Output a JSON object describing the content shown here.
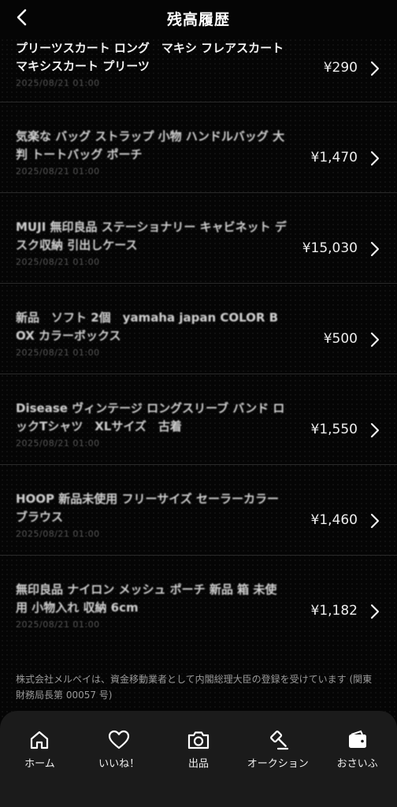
{
  "header": {
    "title": "残高履歴"
  },
  "transactions": [
    {
      "title": "プリーツスカート ロング　マキシ フレアスカート マキシスカート プリーツ",
      "date": "2025/08/21 01:00",
      "amount": "¥290"
    },
    {
      "title": "気楽な バッグ ストラップ 小物 ハンドルバッグ 大判 トートバッグ ポーチ",
      "date": "2025/08/21 01:00",
      "amount": "¥1,470"
    },
    {
      "title": "MUJI 無印良品 ステーショナリー キャビネット デスク収納 引出しケース",
      "date": "2025/08/21 01:00",
      "amount": "¥15,030"
    },
    {
      "title": "新品　ソフト 2個　yamaha japan COLOR BOX カラーボックス",
      "date": "2025/08/21 01:00",
      "amount": "¥500"
    },
    {
      "title": "Disease ヴィンテージ ロングスリーブ バンド ロックTシャツ　XLサイズ　古着",
      "date": "2025/08/21 01:00",
      "amount": "¥1,550"
    },
    {
      "title": "HOOP 新品未使用 フリーサイズ セーラーカラー ブラウス",
      "date": "2025/08/21 01:00",
      "amount": "¥1,460"
    },
    {
      "title": "無印良品 ナイロン メッシュ ポーチ 新品 箱 未使用 小物入れ 収納 6cm",
      "date": "2025/08/21 01:00",
      "amount": "¥1,182"
    }
  ],
  "footnote": "株式会社メルペイは、資金移動業者として内閣総理大臣の登録を受けています (関東財務局長第 00057 号)",
  "nav": {
    "home": "ホーム",
    "likes": "いいね！",
    "sell": "出品",
    "auction": "オークション",
    "wallet": "おさいふ"
  }
}
